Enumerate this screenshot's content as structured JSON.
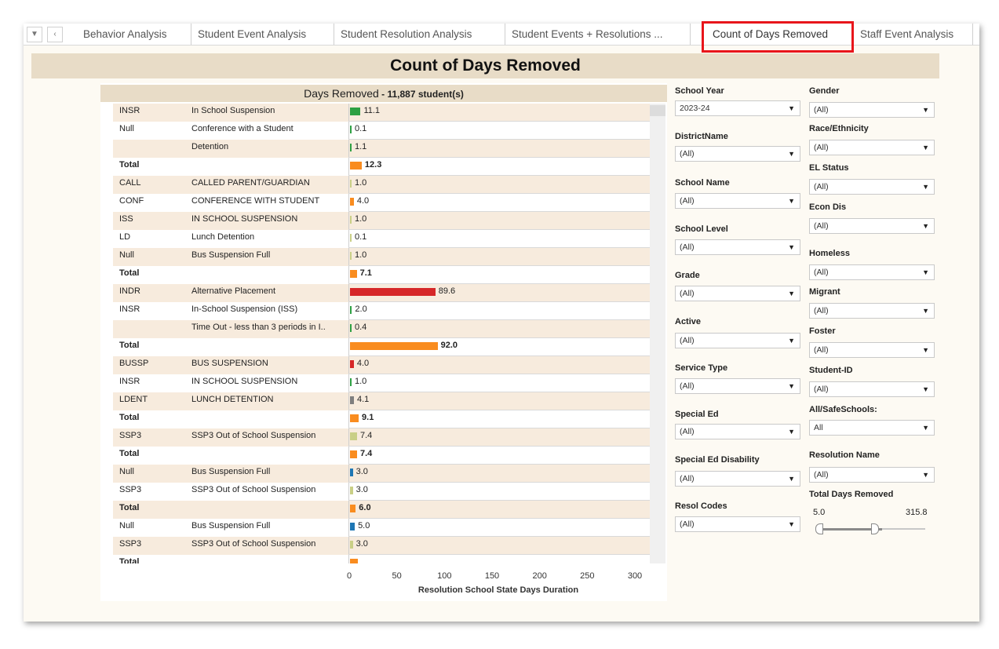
{
  "tabs": {
    "items": [
      "Behavior Analysis",
      "Student Event Analysis",
      "Student Resolution Analysis",
      "Student Events + Resolutions ...",
      "Count of Days Removed",
      "Staff Event Analysis"
    ],
    "active": "Count of Days Removed",
    "controls": {
      "menu_icon": "caret-down-icon",
      "back_icon": "chevron-left-icon"
    }
  },
  "page_title": "Count of Days Removed",
  "chart_header": {
    "title": "Days Removed",
    "count_text": " - 11,887 student(s)"
  },
  "colors": {
    "green": "#2ea043",
    "orange": "#f98c1f",
    "red": "#d62728",
    "blue": "#1f77b4",
    "gray": "#7f7f7f",
    "olive": "#c9cf86",
    "band": "#f7ebdd",
    "header": "#e8dcc7",
    "highlight": "#e8151b"
  },
  "chart_data": {
    "type": "bar",
    "orientation": "horizontal",
    "xlabel": "Resolution School State Days Duration",
    "xlim": [
      0,
      300
    ],
    "xticks": [
      "0",
      "50",
      "100",
      "150",
      "200",
      "250",
      "300"
    ],
    "rows": [
      {
        "code": "INSR",
        "desc": "In School Suspension",
        "value": 11.1,
        "label": "11.1",
        "color": "green",
        "total": false
      },
      {
        "code": "Null",
        "desc": "Conference with a Student",
        "value": 0.1,
        "label": "0.1",
        "color": "green",
        "total": false
      },
      {
        "code": "",
        "desc": "Detention",
        "value": 1.1,
        "label": "1.1",
        "color": "green",
        "total": false
      },
      {
        "code": "Total",
        "desc": "",
        "value": 12.3,
        "label": "12.3",
        "color": "orange",
        "total": true
      },
      {
        "code": "CALL",
        "desc": "CALLED PARENT/GUARDIAN",
        "value": 1.0,
        "label": "1.0",
        "color": "olive",
        "total": false
      },
      {
        "code": "CONF",
        "desc": "CONFERENCE WITH STUDENT",
        "value": 4.0,
        "label": "4.0",
        "color": "orange",
        "total": false
      },
      {
        "code": "ISS",
        "desc": "IN SCHOOL SUSPENSION",
        "value": 1.0,
        "label": "1.0",
        "color": "olive",
        "total": false
      },
      {
        "code": "LD",
        "desc": "Lunch Detention",
        "value": 0.1,
        "label": "0.1",
        "color": "olive",
        "total": false
      },
      {
        "code": "Null",
        "desc": "Bus Suspension Full",
        "value": 1.0,
        "label": "1.0",
        "color": "olive",
        "total": false
      },
      {
        "code": "Total",
        "desc": "",
        "value": 7.1,
        "label": "7.1",
        "color": "orange",
        "total": true
      },
      {
        "code": "INDR",
        "desc": "Alternative Placement",
        "value": 89.6,
        "label": "89.6",
        "color": "red",
        "total": false
      },
      {
        "code": "INSR",
        "desc": "In-School Suspension (ISS)",
        "value": 2.0,
        "label": "2.0",
        "color": "green",
        "total": false
      },
      {
        "code": "",
        "desc": "Time Out - less than 3 periods in I..",
        "value": 0.4,
        "label": "0.4",
        "color": "green",
        "total": false
      },
      {
        "code": "Total",
        "desc": "",
        "value": 92.0,
        "label": "92.0",
        "color": "orange",
        "total": true
      },
      {
        "code": "BUSSP",
        "desc": "BUS SUSPENSION",
        "value": 4.0,
        "label": "4.0",
        "color": "red",
        "total": false
      },
      {
        "code": "INSR",
        "desc": "IN SCHOOL SUSPENSION",
        "value": 1.0,
        "label": "1.0",
        "color": "green",
        "total": false
      },
      {
        "code": "LDENT",
        "desc": "LUNCH DETENTION",
        "value": 4.1,
        "label": "4.1",
        "color": "gray",
        "total": false
      },
      {
        "code": "Total",
        "desc": "",
        "value": 9.1,
        "label": "9.1",
        "color": "orange",
        "total": true
      },
      {
        "code": "SSP3",
        "desc": "SSP3 Out of School Suspension",
        "value": 7.4,
        "label": "7.4",
        "color": "olive",
        "total": false
      },
      {
        "code": "Total",
        "desc": "",
        "value": 7.4,
        "label": "7.4",
        "color": "orange",
        "total": true
      },
      {
        "code": "Null",
        "desc": "Bus Suspension Full",
        "value": 3.0,
        "label": "3.0",
        "color": "blue",
        "total": false
      },
      {
        "code": "SSP3",
        "desc": "SSP3 Out of School Suspension",
        "value": 3.0,
        "label": "3.0",
        "color": "olive",
        "total": false
      },
      {
        "code": "Total",
        "desc": "",
        "value": 6.0,
        "label": "6.0",
        "color": "orange",
        "total": true
      },
      {
        "code": "Null",
        "desc": "Bus Suspension Full",
        "value": 5.0,
        "label": "5.0",
        "color": "blue",
        "total": false
      },
      {
        "code": "SSP3",
        "desc": "SSP3 Out of School Suspension",
        "value": 3.0,
        "label": "3.0",
        "color": "olive",
        "total": false
      },
      {
        "code": "Total",
        "desc": "",
        "value": 8.0,
        "label": "",
        "color": "orange",
        "total": true
      }
    ]
  },
  "filters": {
    "school_year": {
      "label": "School Year",
      "value": "2023-24"
    },
    "district_name": {
      "label": "DistrictName",
      "value": "(All)"
    },
    "school_name": {
      "label": "School Name",
      "value": "(All)"
    },
    "school_level": {
      "label": "School Level",
      "value": "(All)"
    },
    "grade": {
      "label": "Grade",
      "value": "(All)"
    },
    "active": {
      "label": "Active",
      "value": "(All)"
    },
    "service_type": {
      "label": "Service Type",
      "value": "(All)"
    },
    "special_ed": {
      "label": "Special Ed",
      "value": "(All)"
    },
    "special_ed_disability": {
      "label": "Special Ed Disability",
      "value": "(All)"
    },
    "resol_codes": {
      "label": "Resol Codes",
      "value": "(All)"
    },
    "gender": {
      "label": "Gender",
      "value": "(All)"
    },
    "race_ethnicity": {
      "label": "Race/Ethnicity",
      "value": "(All)"
    },
    "el_status": {
      "label": "EL Status",
      "value": "(All)"
    },
    "econ_dis": {
      "label": "Econ Dis",
      "value": "(All)"
    },
    "homeless": {
      "label": "Homeless",
      "value": "(All)"
    },
    "migrant": {
      "label": "Migrant",
      "value": "(All)"
    },
    "foster": {
      "label": "Foster",
      "value": "(All)"
    },
    "student_id": {
      "label": "Student-ID",
      "value": "(All)"
    },
    "all_safe_schools": {
      "label": "All/SafeSchools:",
      "value": "All"
    },
    "resolution_name": {
      "label": "Resolution Name",
      "value": "(All)"
    },
    "total_days_removed": {
      "label": "Total Days Removed",
      "min": "5.0",
      "max": "315.8",
      "range_min": 5.0,
      "range_max": 315.8,
      "low_fraction": 0.0,
      "high_fraction": 0.6
    }
  }
}
